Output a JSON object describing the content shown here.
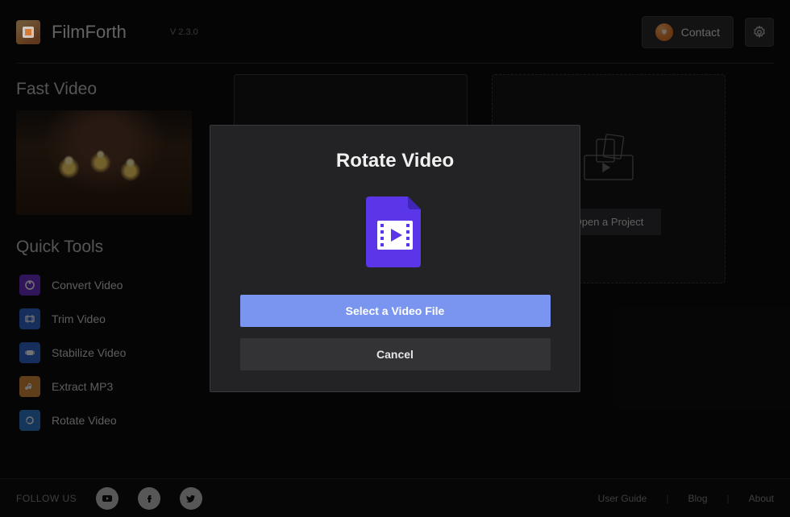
{
  "app": {
    "name": "FilmForth",
    "version": "V 2.3.0"
  },
  "header": {
    "contact_label": "Contact"
  },
  "fast_video": {
    "title": "Fast Video"
  },
  "quick_tools": {
    "title": "Quick Tools",
    "items": [
      {
        "label": "Convert Video"
      },
      {
        "label": "Trim Video"
      },
      {
        "label": "Stabilize Video"
      },
      {
        "label": "Extract MP3"
      },
      {
        "label": "Rotate Video"
      }
    ]
  },
  "projects": {
    "open_label": "Open a Project"
  },
  "modal": {
    "title": "Rotate Video",
    "select_label": "Select a Video File",
    "cancel_label": "Cancel"
  },
  "footer": {
    "follow_label": "FOLLOW US",
    "links": [
      {
        "label": "User Guide"
      },
      {
        "label": "Blog"
      },
      {
        "label": "About"
      }
    ]
  }
}
